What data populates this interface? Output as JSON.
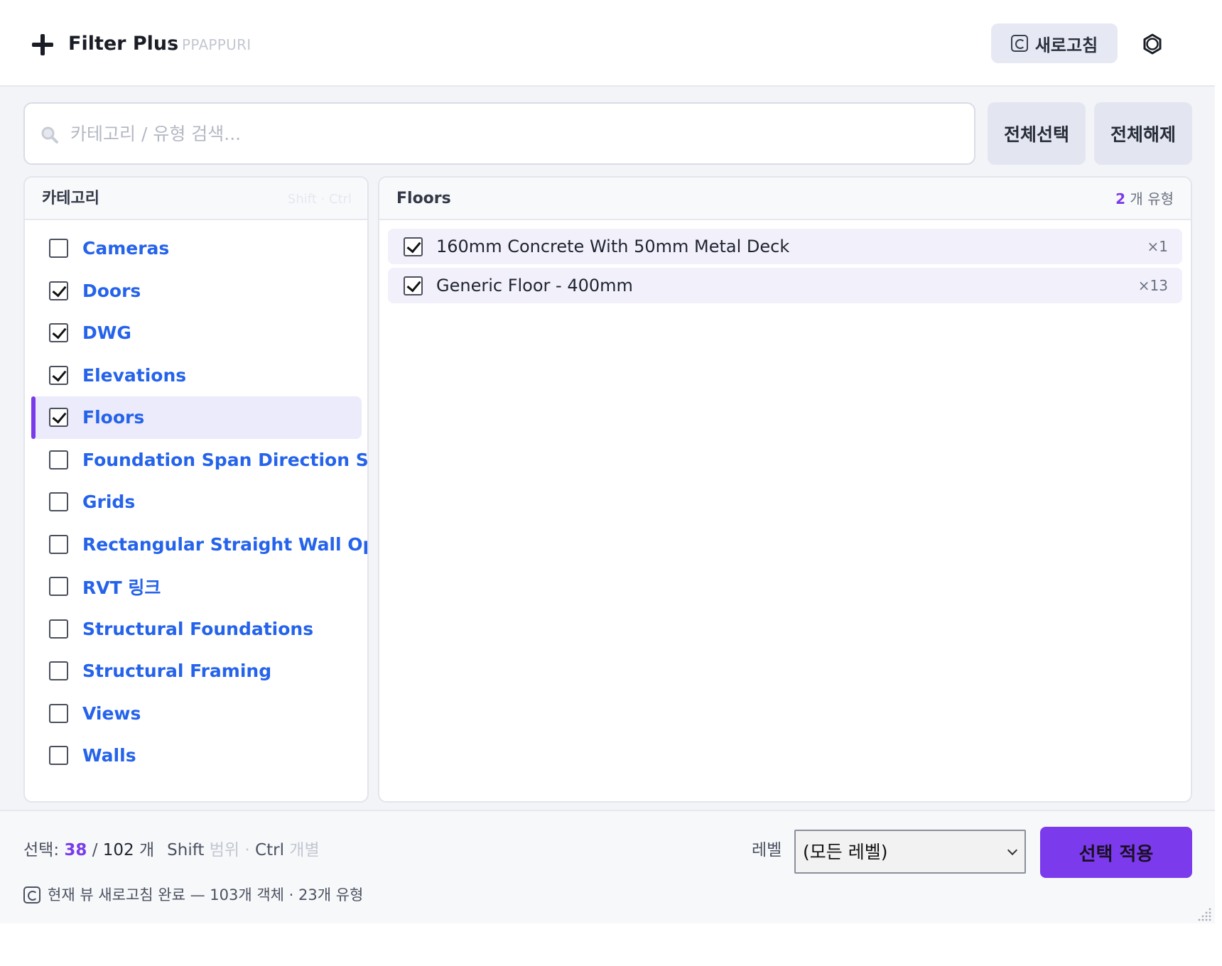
{
  "header": {
    "title": "Filter Plus",
    "separator": "·",
    "subtitle": "PPAPPURI",
    "refresh_label": "새로고침"
  },
  "search": {
    "placeholder": "카테고리 / 유형 검색..."
  },
  "actions": {
    "select_all": "전체선택",
    "deselect_all": "전체해제"
  },
  "category_panel": {
    "title": "카테고리",
    "hint": "Shift · Ctrl",
    "items": [
      {
        "label": "Cameras",
        "checked": false,
        "active": false
      },
      {
        "label": "Doors",
        "checked": true,
        "active": false
      },
      {
        "label": "DWG",
        "checked": true,
        "active": false
      },
      {
        "label": "Elevations",
        "checked": true,
        "active": false
      },
      {
        "label": "Floors",
        "checked": true,
        "active": true
      },
      {
        "label": "Foundation Span Direction S...",
        "checked": false,
        "active": false
      },
      {
        "label": "Grids",
        "checked": false,
        "active": false
      },
      {
        "label": "Rectangular Straight Wall Op...",
        "checked": false,
        "active": false
      },
      {
        "label": "RVT 링크",
        "checked": false,
        "active": false
      },
      {
        "label": "Structural Foundations",
        "checked": false,
        "active": false
      },
      {
        "label": "Structural Framing",
        "checked": false,
        "active": false
      },
      {
        "label": "Views",
        "checked": false,
        "active": false
      },
      {
        "label": "Walls",
        "checked": false,
        "active": false
      }
    ]
  },
  "type_panel": {
    "title": "Floors",
    "count_num": "2",
    "count_suffix": " 개 유형",
    "items": [
      {
        "label": "160mm Concrete With 50mm Metal Deck",
        "count": "×1",
        "checked": true
      },
      {
        "label": "Generic Floor - 400mm",
        "count": "×13",
        "checked": true
      }
    ]
  },
  "footer": {
    "selection_prefix": "선택: ",
    "selected": "38",
    "slash": " / ",
    "total": "102",
    "unit": " 개",
    "shift_key": "Shift",
    "shift_desc": " 범위 · ",
    "ctrl_key": "Ctrl",
    "ctrl_desc": " 개별",
    "level_label": "레벨",
    "level_value": "(모든 레벨)",
    "apply_label": "선택 적용",
    "status": "현재 뷰 새로고침 완료 — 103개 객체 · 23개 유형"
  },
  "colors": {
    "accent": "#7c3aed",
    "link": "#2563eb",
    "active_row": "#ecebfb"
  },
  "icons": [
    "plus-icon",
    "refresh-icon",
    "settings-icon",
    "search-icon",
    "checkbox-icon",
    "resize-grip-icon"
  ]
}
